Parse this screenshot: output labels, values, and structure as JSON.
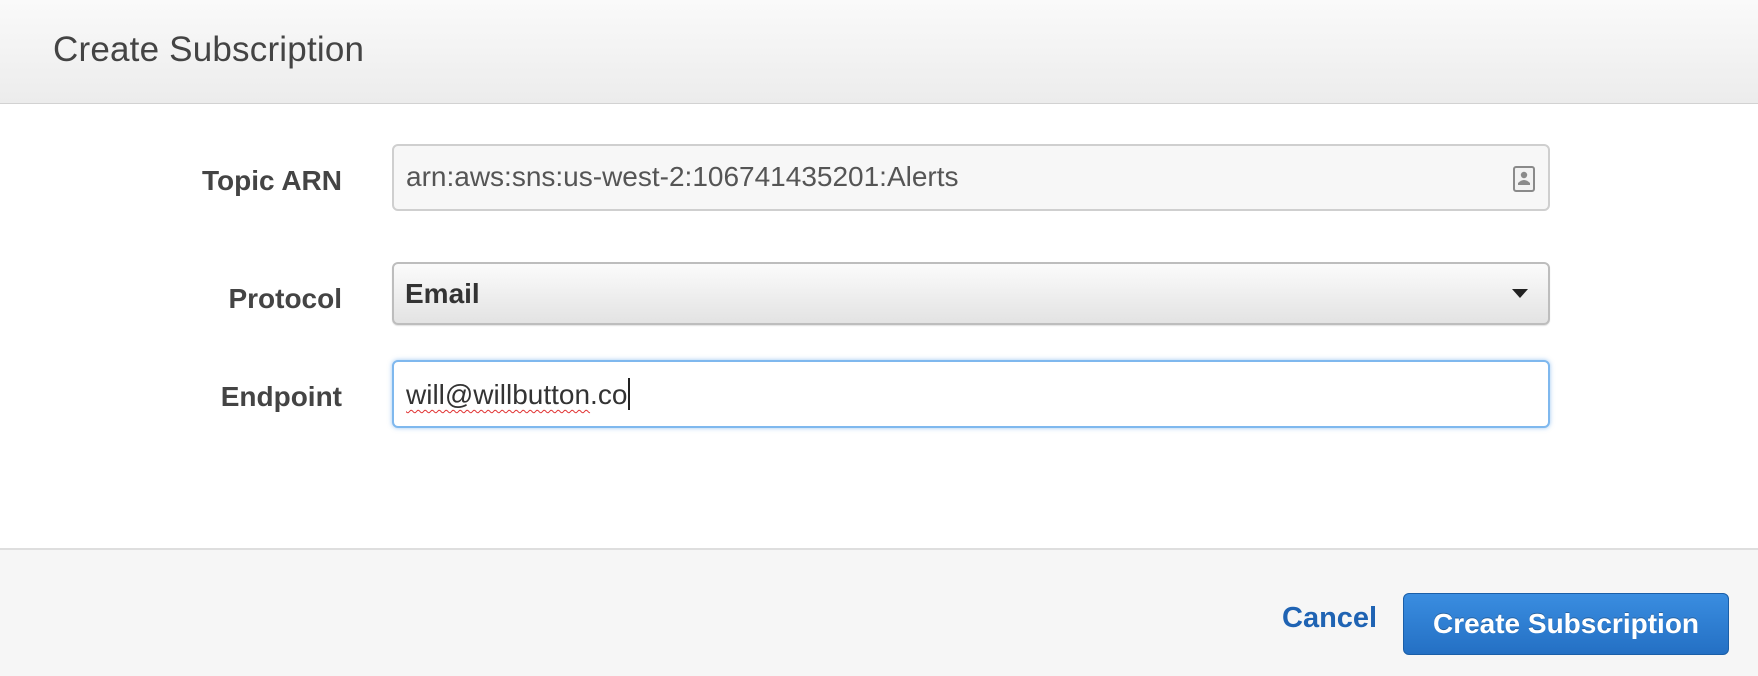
{
  "dialog": {
    "title": "Create Subscription"
  },
  "form": {
    "topic_arn": {
      "label": "Topic ARN",
      "value": "arn:aws:sns:us-west-2:106741435201:Alerts",
      "icon": "contact-card-icon"
    },
    "protocol": {
      "label": "Protocol",
      "selected": "Email",
      "icon": "caret-down-icon"
    },
    "endpoint": {
      "label": "Endpoint",
      "value_misspelled": "will@willbutton",
      "value_rest": ".co"
    }
  },
  "footer": {
    "cancel_label": "Cancel",
    "submit_label": "Create Subscription"
  },
  "colors": {
    "primary_button": "#2470c4",
    "link": "#1f63b3",
    "focus_border": "#7fb8ee"
  }
}
